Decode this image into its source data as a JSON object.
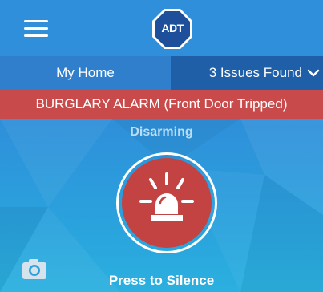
{
  "header": {
    "logo_text": "ADT",
    "icons": {
      "menu": "hamburger-menu-icon",
      "logo": "adt-octagon-logo-icon"
    }
  },
  "location_bar": {
    "home_label": "My Home",
    "issues_label": "3 Issues Found",
    "issues_icon": "chevron-down-icon"
  },
  "alert_banner": {
    "text": "BURGLARY ALARM (Front Door Tripped)"
  },
  "main": {
    "status_text": "Disarming",
    "siren_icon": "siren-icon",
    "camera_icon": "camera-icon",
    "action_label": "Press to Silence"
  },
  "colors": {
    "header_blue": "#2f8fda",
    "home_tab_blue": "#2f7fcc",
    "issues_tab_blue": "#1f5fa8",
    "alarm_red": "#c94a4a",
    "siren_red": "#c34343",
    "status_text": "#b9ddf5"
  }
}
